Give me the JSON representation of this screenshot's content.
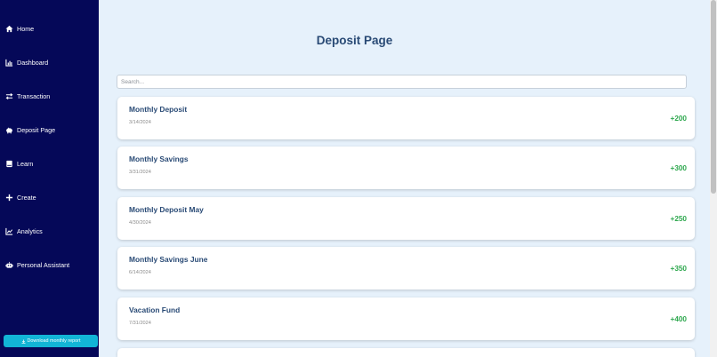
{
  "sidebar": {
    "items": [
      {
        "label": "Home",
        "icon": "home-icon"
      },
      {
        "label": "Dashboard",
        "icon": "chart-bar-icon"
      },
      {
        "label": "Transaction",
        "icon": "exchange-icon"
      },
      {
        "label": "Deposit Page",
        "icon": "piggy-bank-icon"
      },
      {
        "label": "Learn",
        "icon": "book-icon"
      },
      {
        "label": "Create",
        "icon": "plus-icon"
      },
      {
        "label": "Analytics",
        "icon": "line-chart-icon"
      },
      {
        "label": "Personal Assistant",
        "icon": "robot-icon"
      }
    ],
    "download_label": "Download monthly report"
  },
  "main": {
    "title": "Deposit Page",
    "search": {
      "placeholder": "Search...",
      "value": ""
    },
    "deposits": [
      {
        "title": "Monthly Deposit",
        "date": "3/14/2024",
        "amount": "+200"
      },
      {
        "title": "Monthly Savings",
        "date": "3/31/2024",
        "amount": "+300"
      },
      {
        "title": "Monthly Deposit May",
        "date": "4/30/2024",
        "amount": "+250"
      },
      {
        "title": "Monthly Savings June",
        "date": "6/14/2024",
        "amount": "+350"
      },
      {
        "title": "Vacation Fund",
        "date": "7/31/2024",
        "amount": "+400"
      }
    ]
  },
  "colors": {
    "sidebar_bg": "#050858",
    "page_bg": "#e6f1fb",
    "title": "#294a75",
    "amount_positive": "#2fa84f",
    "download_button": "#12b5d6"
  }
}
